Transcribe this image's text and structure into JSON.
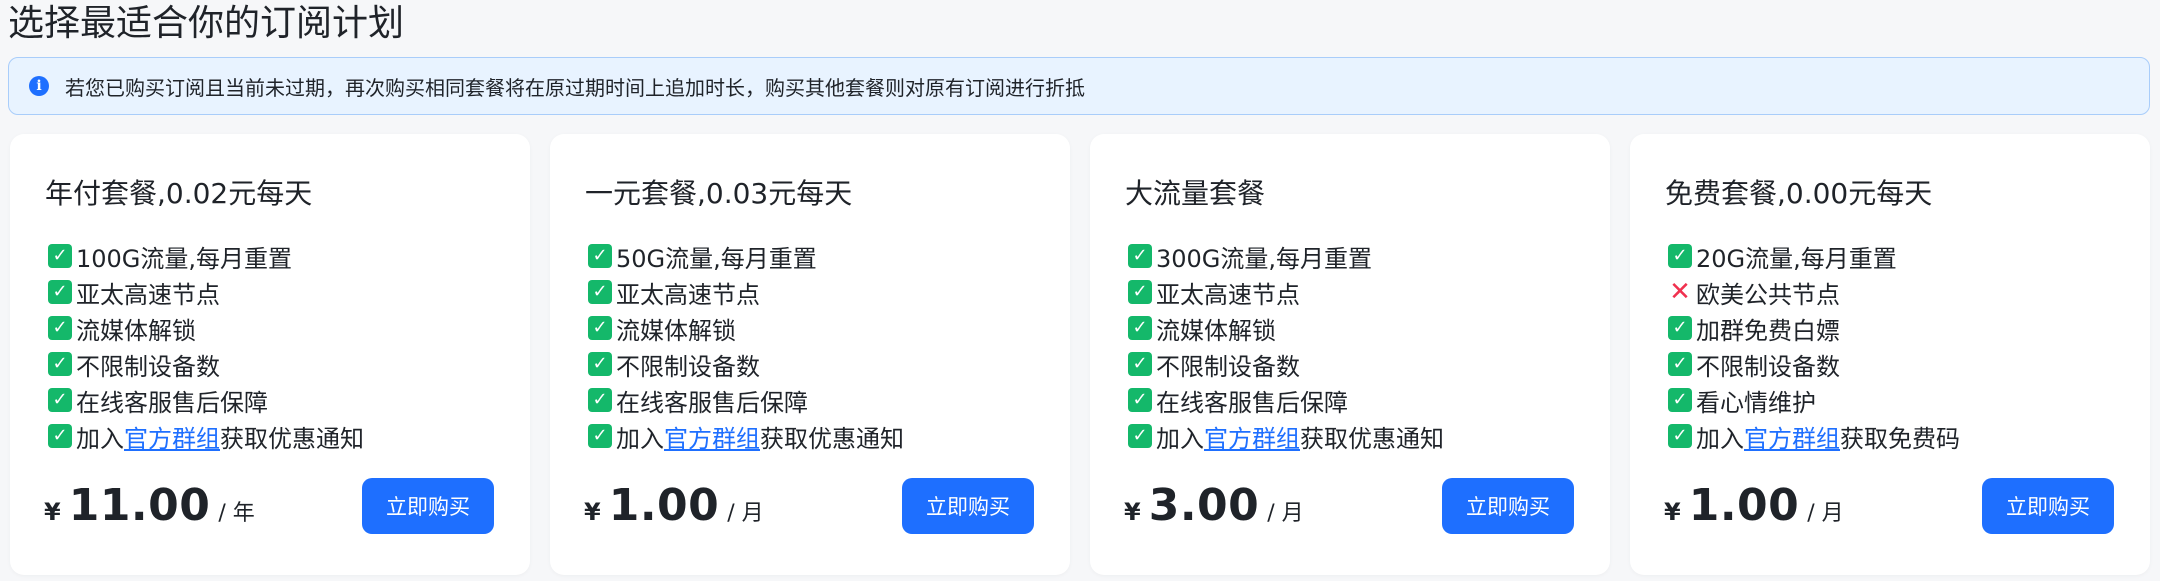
{
  "page": {
    "title": "选择最适合你的订阅计划"
  },
  "notice": {
    "icon": "info-icon",
    "text": "若您已购买订阅且当前未过期，再次购买相同套餐将在原过期时间上追加时长，购买其他套餐则对原有订阅进行折抵"
  },
  "colors": {
    "accent": "#1e6fff",
    "check": "#14b86a",
    "cross": "#f0314f",
    "notice_bg": "#e8f3ff"
  },
  "plans": [
    {
      "title": "年付套餐,0.02元每天",
      "features": [
        {
          "icon": "check-icon",
          "text": "100G流量,每月重置"
        },
        {
          "icon": "check-icon",
          "text": "亚太高速节点"
        },
        {
          "icon": "check-icon",
          "text": "流媒体解锁"
        },
        {
          "icon": "check-icon",
          "text": "不限制设备数"
        },
        {
          "icon": "check-icon",
          "text": "在线客服售后保障"
        },
        {
          "icon": "check-icon",
          "prefix": "加入",
          "link": "官方群组",
          "suffix": "获取优惠通知"
        }
      ],
      "currency": "¥",
      "price": "11.00",
      "period": "/ 年",
      "button": "立即购买"
    },
    {
      "title": "一元套餐,0.03元每天",
      "features": [
        {
          "icon": "check-icon",
          "text": "50G流量,每月重置"
        },
        {
          "icon": "check-icon",
          "text": "亚太高速节点"
        },
        {
          "icon": "check-icon",
          "text": "流媒体解锁"
        },
        {
          "icon": "check-icon",
          "text": "不限制设备数"
        },
        {
          "icon": "check-icon",
          "text": "在线客服售后保障"
        },
        {
          "icon": "check-icon",
          "prefix": "加入",
          "link": "官方群组",
          "suffix": "获取优惠通知"
        }
      ],
      "currency": "¥",
      "price": "1.00",
      "period": "/ 月",
      "button": "立即购买"
    },
    {
      "title": "大流量套餐",
      "features": [
        {
          "icon": "check-icon",
          "text": "300G流量,每月重置"
        },
        {
          "icon": "check-icon",
          "text": "亚太高速节点"
        },
        {
          "icon": "check-icon",
          "text": "流媒体解锁"
        },
        {
          "icon": "check-icon",
          "text": "不限制设备数"
        },
        {
          "icon": "check-icon",
          "text": "在线客服售后保障"
        },
        {
          "icon": "check-icon",
          "prefix": "加入",
          "link": "官方群组",
          "suffix": "获取优惠通知"
        }
      ],
      "currency": "¥",
      "price": "3.00",
      "period": "/ 月",
      "button": "立即购买"
    },
    {
      "title": "免费套餐,0.00元每天",
      "features": [
        {
          "icon": "check-icon",
          "text": "20G流量,每月重置"
        },
        {
          "icon": "cross-icon",
          "text": "欧美公共节点"
        },
        {
          "icon": "check-icon",
          "text": "加群免费白嫖"
        },
        {
          "icon": "check-icon",
          "text": "不限制设备数"
        },
        {
          "icon": "check-icon",
          "text": "看心情维护"
        },
        {
          "icon": "check-icon",
          "prefix": "加入",
          "link": "官方群组",
          "suffix": "获取免费码"
        }
      ],
      "currency": "¥",
      "price": "1.00",
      "period": "/ 月",
      "button": "立即购买"
    }
  ]
}
